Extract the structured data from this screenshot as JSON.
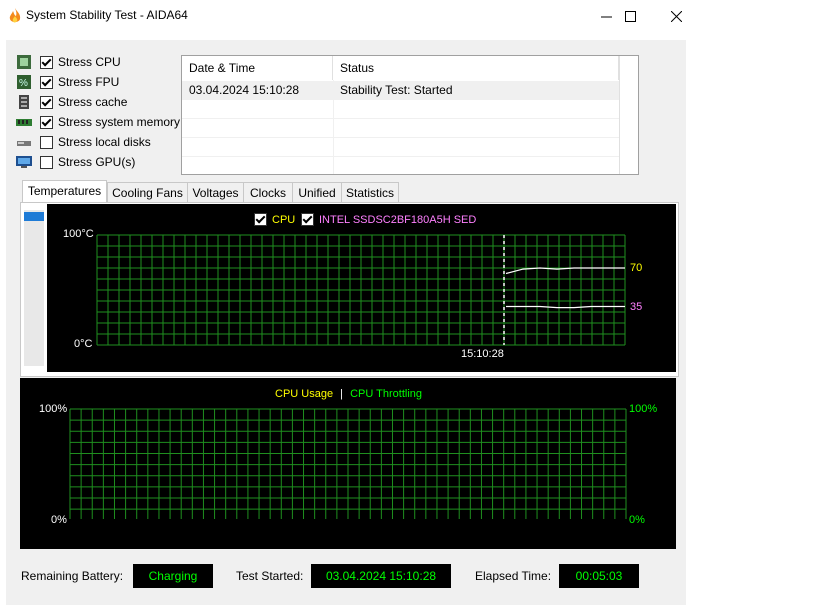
{
  "window": {
    "title": "System Stability Test - AIDA64",
    "controls": {
      "minimize": "—",
      "maximize": "☐",
      "close": "✕"
    }
  },
  "options": [
    {
      "label": "Stress CPU",
      "checked": true,
      "icon": "cpu-icon"
    },
    {
      "label": "Stress FPU",
      "checked": true,
      "icon": "fpu-icon"
    },
    {
      "label": "Stress cache",
      "checked": true,
      "icon": "cache-icon"
    },
    {
      "label": "Stress system memory",
      "checked": true,
      "icon": "memory-icon"
    },
    {
      "label": "Stress local disks",
      "checked": false,
      "icon": "disk-icon"
    },
    {
      "label": "Stress GPU(s)",
      "checked": false,
      "icon": "gpu-icon"
    }
  ],
  "log": {
    "columns": [
      "Date & Time",
      "Status"
    ],
    "rows": [
      {
        "datetime": "03.04.2024 15:10:28",
        "status": "Stability Test: Started"
      }
    ]
  },
  "tabs": [
    "Temperatures",
    "Cooling Fans",
    "Voltages",
    "Clocks",
    "Unified",
    "Statistics"
  ],
  "active_tab": "Temperatures",
  "temperature_chart": {
    "legend": [
      {
        "label": "CPU",
        "checked": true,
        "color": "#ffff00"
      },
      {
        "label": "INTEL SSDSC2BF180A5H SED",
        "checked": true,
        "color": "#ff80ff"
      }
    ],
    "y_max_label": "100°C",
    "y_min_label": "0°C",
    "x_marker_label": "15:10:28",
    "series_values": [
      "70",
      "35"
    ]
  },
  "usage_chart": {
    "legend_usage": "CPU Usage",
    "legend_sep": "|",
    "legend_throttling": "CPU Throttling",
    "left_max": "100%",
    "left_min": "0%",
    "right_max": "100%",
    "right_min": "0%"
  },
  "status_bar": {
    "battery_label": "Remaining Battery:",
    "battery_value": "Charging",
    "started_label": "Test Started:",
    "started_value": "03.04.2024 15:10:28",
    "elapsed_label": "Elapsed Time:",
    "elapsed_value": "00:05:03"
  },
  "chart_data": [
    {
      "type": "line",
      "y_unit": "°C",
      "ylim": [
        0,
        100
      ],
      "marker_time": "15:10:28",
      "series": [
        {
          "name": "CPU",
          "values": [
            65,
            69,
            70,
            69,
            70,
            70,
            70,
            70
          ]
        },
        {
          "name": "INTEL SSDSC2BF180A5H SED",
          "values": [
            35,
            35,
            35,
            34,
            34,
            35,
            35,
            35
          ]
        }
      ]
    },
    {
      "type": "line",
      "ylim": [
        0,
        100
      ],
      "series": []
    }
  ]
}
